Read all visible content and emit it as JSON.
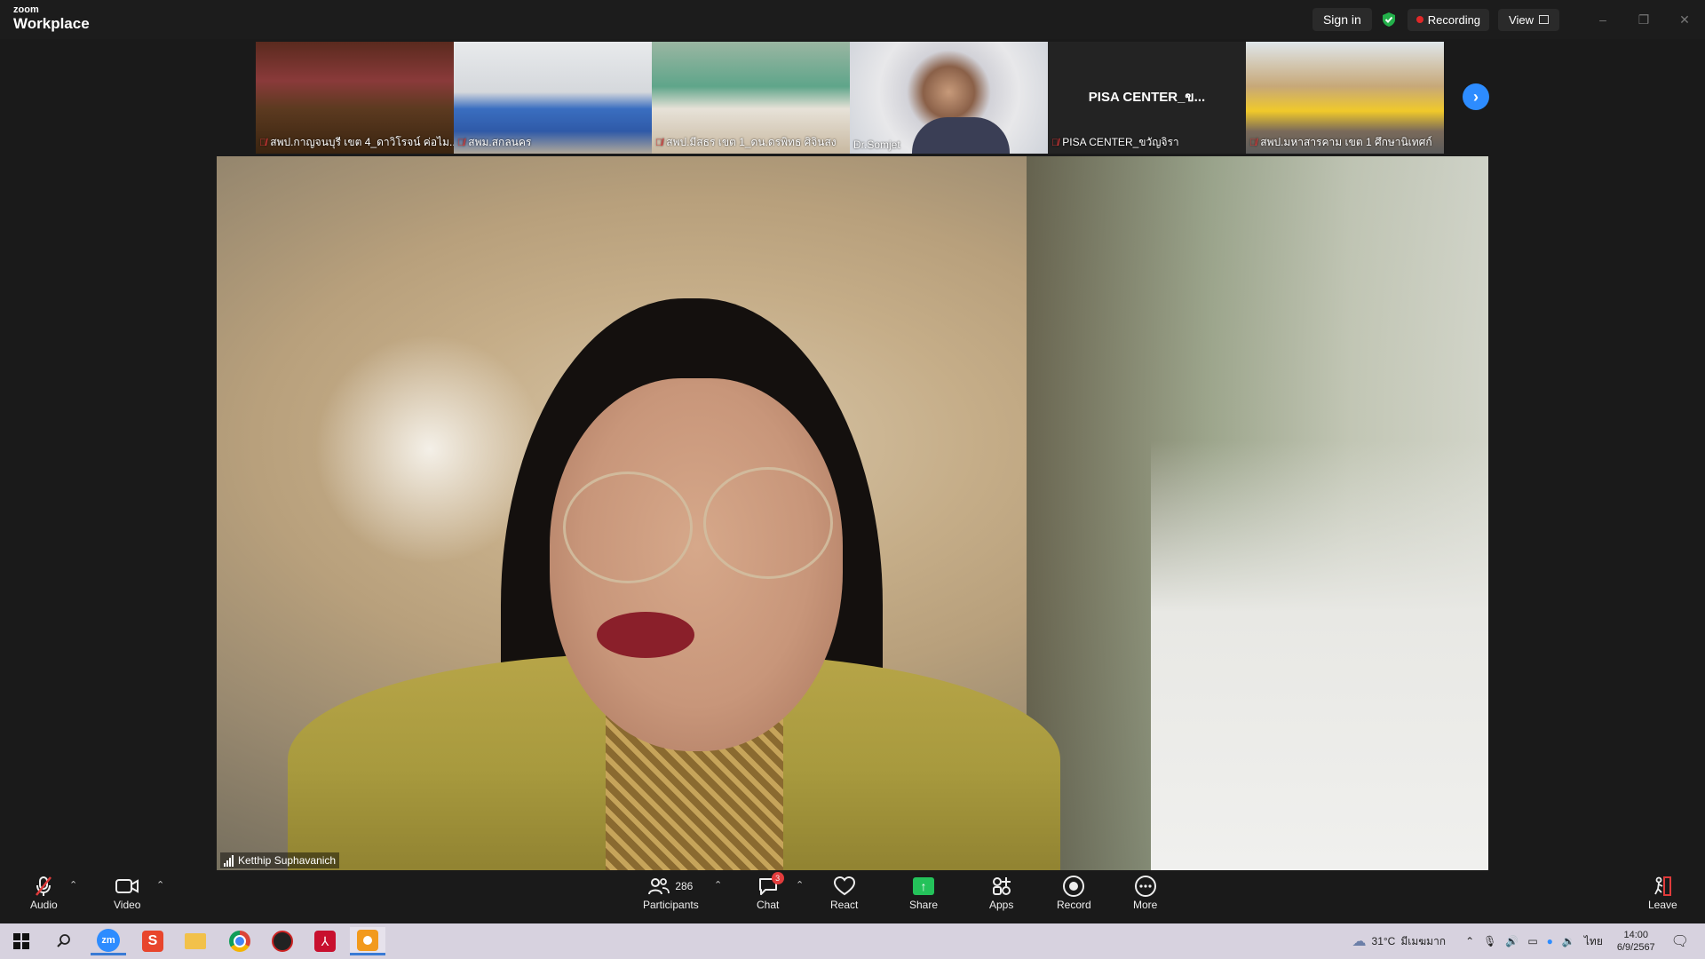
{
  "app": {
    "logo_top": "zoom",
    "logo_bottom": "Workplace"
  },
  "header": {
    "sign_in": "Sign in",
    "recording": "Recording",
    "view": "View",
    "win_controls": [
      "–",
      "❐",
      "✕"
    ]
  },
  "gallery": {
    "tiles": [
      {
        "label": "สพป.กาญจนบุรี เขต 4_ดาวิโรจน์ ค่อไม...",
        "muted": true
      },
      {
        "label": "สพม.สกลนคร",
        "muted": true
      },
      {
        "label": "สพป.มีสธร เขต 1_ดน.ดรพิทธ ศิจินสง",
        "muted": true
      },
      {
        "label": "Dr.Somjet",
        "muted": false
      },
      {
        "label": "PISA CENTER_ขวัญจิรา",
        "muted": true,
        "name_display": "PISA  CENTER_ข..."
      },
      {
        "label": "สพป.มหาสารคาม เขต 1 ศึกษานิเทศก์",
        "muted": true
      }
    ],
    "next_icon": "chevron-right-icon"
  },
  "main_video": {
    "speaker": "Ketthip Suphavanich"
  },
  "toolbar": {
    "audio": "Audio",
    "video": "Video",
    "participants": "Participants",
    "participants_count": "286",
    "chat": "Chat",
    "chat_badge": "3",
    "react": "React",
    "share": "Share",
    "apps": "Apps",
    "record": "Record",
    "more": "More",
    "leave": "Leave"
  },
  "taskbar": {
    "weather": "31°C",
    "weather_desc": "มีเมฆมาก",
    "lang": "ไทย",
    "time": "14:00",
    "date": "6/9/2567"
  },
  "colors": {
    "accent": "#2d8cff",
    "recording": "#e02828",
    "share": "#24c25a",
    "mute": "#e03b3b"
  }
}
